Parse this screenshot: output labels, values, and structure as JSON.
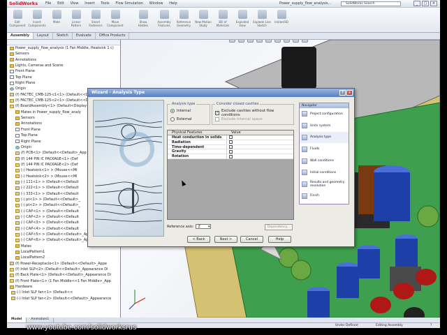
{
  "app": {
    "brand": "SolidWorks",
    "window_title": "Power_supply_flow_analysis...",
    "search_placeholder": "SolidWorks Search"
  },
  "menu": [
    "File",
    "Edit",
    "View",
    "Insert",
    "Tools",
    "Flow Simulation",
    "Window",
    "Help"
  ],
  "window_controls": {
    "minimize": "_",
    "restore": "□",
    "close": "×"
  },
  "ribbon": [
    "Edit Component",
    "Insert Components",
    "Mate",
    "Linear Pattern",
    "Smart Fasteners",
    "Move Component",
    "Show Hidden",
    "Assembly Features",
    "Reference Geometry",
    "New Motion Study",
    "Bill of Materials",
    "Exploded View",
    "Explode Line Sketch",
    "Instant3D"
  ],
  "command_tabs": [
    "Assembly",
    "Layout",
    "Sketch",
    "Evaluate",
    "Office Products"
  ],
  "tree": [
    "Power_supply_flow_analysis (1 Fan Middle, Heatsink 1 c)",
    "Sensors",
    "Annotations",
    "Lights, Cameras and Scene",
    "Front Plane",
    "Top Plane",
    "Right Plane",
    "Origin",
    "(f) FACTEC_CMB-125-c1<1> (Default<<Default>_",
    "(f) FACTEC_CMB-125-c2<1> (Default<<Default>_",
    "(f) BoardAssembly<1> (Default<Display",
    "Mates in Power_supply_flow_analy",
    "Sensors",
    "Annotations",
    "Front Plane",
    "Top Plane",
    "Right Plane",
    "Origin",
    "(f) PCB<1> (Default<<Default>_App",
    "(f) 144 PIN IC PACKAGE<1> (Def",
    "(f) 144 PIN IC PACKAGE<2> (Def",
    "(-) Heatsink<1> > (Mouse<<Mi",
    "(-) Heatsink<2> > (Mouse<<Mi",
    "(-) 111<1> > (Default<<Default",
    "(-) 222<1> > (Default<<Default",
    "(-) 333<1> > (Default<<Default",
    "(-) pt<1> > (Default<<Default>_",
    "(-) pt<2> > (Default<<Default>_",
    "(-) CAP<1> > (Default<<Default",
    "(-) CAP<2> > (Default<<Default",
    "(-) CAP<3> > (Default<<Default",
    "(-) CAP<4> > (Default<<Default",
    "(-) CAP<5> > (Default<<Default>_Appearance",
    "(-) CAP<6> > (Default<<Default>_Appearance",
    "Mates",
    "LocalPattern1",
    "LocalPattern2",
    "(f) Power-Receptacle<1> (Default<<Default>_Appe",
    "(f) Inlet SLP<2> (Default<<Default>_Appearance Di",
    "(f) Back Plate<1> (Default<<Default>_Appearance Di",
    "(f) Front Plate<1> (1 Fan Middle<<1 Fan Middle>_App",
    "Hardware",
    "(-) Inlet SLP fan<1> (Default<<",
    "(-) Inlet SLP fan<2> (Default<<Default>_Appearance"
  ],
  "bottom_tabs": [
    "Model",
    "Animation1"
  ],
  "status": {
    "state": "Under Defined",
    "mode": "Editing Assembly",
    "help": "?"
  },
  "watermark_url": "www.youtube.com/solidworksrus",
  "dialog": {
    "title": "Wizard - Analysis Type",
    "help_btn": "?",
    "close_btn": "×",
    "analysis_type_label": "Analysis type",
    "internal_label": "Internal",
    "external_label": "External",
    "consider_label": "Consider closed cavities",
    "exclude_label": "Exclude cavities without flow conditions",
    "exclude_internal_label": "Exclude internal space",
    "col_physical": "Physical Features",
    "col_value": "Value",
    "features": [
      "Heat conduction in solids",
      "Radiation",
      "Time-dependent",
      "Gravity",
      "Rotation"
    ],
    "reference_axis_label": "Reference axis:",
    "reference_axis_value": "Z",
    "dependency_label": "Dependency...",
    "navigator_title": "Navigator",
    "navigator": [
      "Project configuration",
      "Units system",
      "Analysis type",
      "Fluids",
      "Wall conditions",
      "Initial conditions",
      "Results and geometry resolution",
      "Finish"
    ],
    "buttons": {
      "back": "< Back",
      "next": "Next >",
      "cancel": "Cancel",
      "help": "Help"
    }
  },
  "colors": {
    "accent": "#5a7fc2",
    "brand": "#c8102e",
    "board": "#2e9a43",
    "cap_blue": "#1d3fa8",
    "chassis": "#cdb55f"
  }
}
